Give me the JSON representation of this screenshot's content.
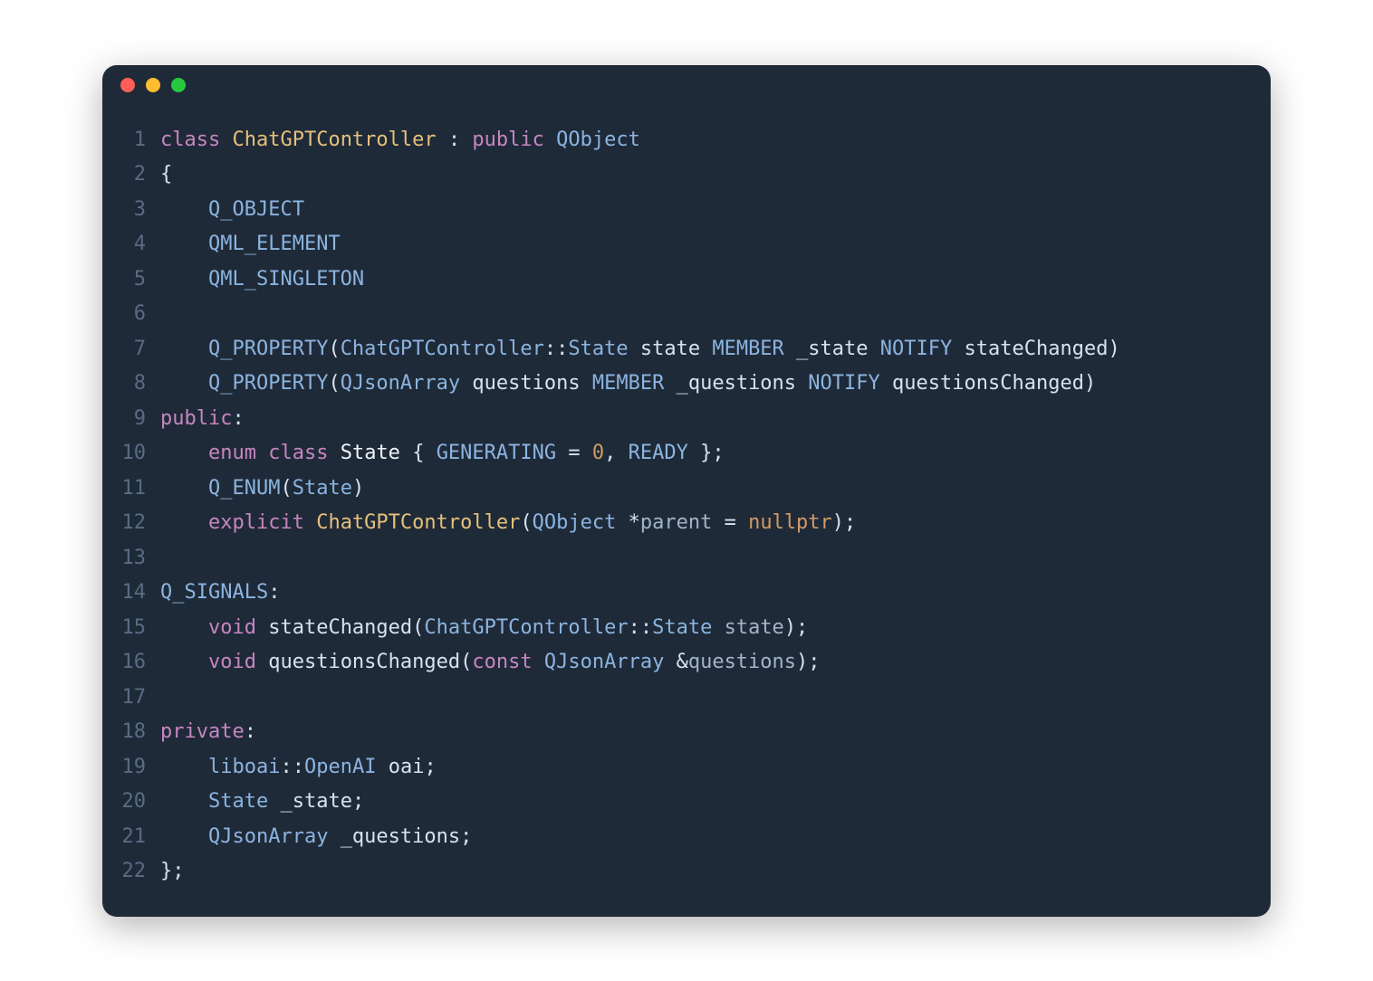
{
  "window": {
    "traffic_lights": {
      "close_color": "#ff5f56",
      "minimize_color": "#ffbd2e",
      "maximize_color": "#27c93f"
    }
  },
  "code": {
    "lines": [
      {
        "n": "1",
        "tokens": [
          [
            "keyword",
            "class"
          ],
          [
            "plain",
            " "
          ],
          [
            "typedef",
            "ChatGPTController"
          ],
          [
            "plain",
            " "
          ],
          [
            "punct",
            ":"
          ],
          [
            "plain",
            " "
          ],
          [
            "keyword",
            "public"
          ],
          [
            "plain",
            " "
          ],
          [
            "type",
            "QObject"
          ]
        ]
      },
      {
        "n": "2",
        "tokens": [
          [
            "punct",
            "{"
          ]
        ]
      },
      {
        "n": "3",
        "tokens": [
          [
            "plain",
            "    "
          ],
          [
            "macro",
            "Q_OBJECT"
          ]
        ]
      },
      {
        "n": "4",
        "tokens": [
          [
            "plain",
            "    "
          ],
          [
            "macro",
            "QML_ELEMENT"
          ]
        ]
      },
      {
        "n": "5",
        "tokens": [
          [
            "plain",
            "    "
          ],
          [
            "macro",
            "QML_SINGLETON"
          ]
        ]
      },
      {
        "n": "6",
        "tokens": [
          [
            "plain",
            " "
          ]
        ]
      },
      {
        "n": "7",
        "tokens": [
          [
            "plain",
            "    "
          ],
          [
            "macro",
            "Q_PROPERTY"
          ],
          [
            "punct",
            "("
          ],
          [
            "type",
            "ChatGPTController"
          ],
          [
            "punct",
            "::"
          ],
          [
            "type",
            "State"
          ],
          [
            "plain",
            " "
          ],
          [
            "ident",
            "state"
          ],
          [
            "plain",
            " "
          ],
          [
            "macro",
            "MEMBER"
          ],
          [
            "plain",
            " "
          ],
          [
            "ident",
            "_state"
          ],
          [
            "plain",
            " "
          ],
          [
            "macro",
            "NOTIFY"
          ],
          [
            "plain",
            " "
          ],
          [
            "ident",
            "stateChanged"
          ],
          [
            "punct",
            ")"
          ]
        ]
      },
      {
        "n": "8",
        "tokens": [
          [
            "plain",
            "    "
          ],
          [
            "macro",
            "Q_PROPERTY"
          ],
          [
            "punct",
            "("
          ],
          [
            "type",
            "QJsonArray"
          ],
          [
            "plain",
            " "
          ],
          [
            "ident",
            "questions"
          ],
          [
            "plain",
            " "
          ],
          [
            "macro",
            "MEMBER"
          ],
          [
            "plain",
            " "
          ],
          [
            "ident",
            "_questions"
          ],
          [
            "plain",
            " "
          ],
          [
            "macro",
            "NOTIFY"
          ],
          [
            "plain",
            " "
          ],
          [
            "ident",
            "questionsChanged"
          ],
          [
            "punct",
            ")"
          ]
        ]
      },
      {
        "n": "9",
        "tokens": [
          [
            "keyword",
            "public"
          ],
          [
            "punct",
            ":"
          ]
        ]
      },
      {
        "n": "10",
        "tokens": [
          [
            "plain",
            "    "
          ],
          [
            "keyword",
            "enum"
          ],
          [
            "plain",
            " "
          ],
          [
            "keyword",
            "class"
          ],
          [
            "plain",
            " "
          ],
          [
            "white",
            "State"
          ],
          [
            "plain",
            " "
          ],
          [
            "punct",
            "{"
          ],
          [
            "plain",
            " "
          ],
          [
            "enumval",
            "GENERATING"
          ],
          [
            "plain",
            " "
          ],
          [
            "punct",
            "="
          ],
          [
            "plain",
            " "
          ],
          [
            "number",
            "0"
          ],
          [
            "punct",
            ","
          ],
          [
            "plain",
            " "
          ],
          [
            "enumval",
            "READY"
          ],
          [
            "plain",
            " "
          ],
          [
            "punct",
            "};"
          ]
        ]
      },
      {
        "n": "11",
        "tokens": [
          [
            "plain",
            "    "
          ],
          [
            "macro",
            "Q_ENUM"
          ],
          [
            "punct",
            "("
          ],
          [
            "type",
            "State"
          ],
          [
            "punct",
            ")"
          ]
        ]
      },
      {
        "n": "12",
        "tokens": [
          [
            "plain",
            "    "
          ],
          [
            "keyword",
            "explicit"
          ],
          [
            "plain",
            " "
          ],
          [
            "typedef",
            "ChatGPTController"
          ],
          [
            "punct",
            "("
          ],
          [
            "type",
            "QObject"
          ],
          [
            "plain",
            " "
          ],
          [
            "punct",
            "*"
          ],
          [
            "param",
            "parent"
          ],
          [
            "plain",
            " "
          ],
          [
            "punct",
            "="
          ],
          [
            "plain",
            " "
          ],
          [
            "null",
            "nullptr"
          ],
          [
            "punct",
            ");"
          ]
        ]
      },
      {
        "n": "13",
        "tokens": [
          [
            "plain",
            " "
          ]
        ]
      },
      {
        "n": "14",
        "tokens": [
          [
            "macro",
            "Q_SIGNALS"
          ],
          [
            "punct",
            ":"
          ]
        ]
      },
      {
        "n": "15",
        "tokens": [
          [
            "plain",
            "    "
          ],
          [
            "keyword",
            "void"
          ],
          [
            "plain",
            " "
          ],
          [
            "func",
            "stateChanged"
          ],
          [
            "punct",
            "("
          ],
          [
            "type",
            "ChatGPTController"
          ],
          [
            "punct",
            "::"
          ],
          [
            "type",
            "State"
          ],
          [
            "plain",
            " "
          ],
          [
            "param",
            "state"
          ],
          [
            "punct",
            ");"
          ]
        ]
      },
      {
        "n": "16",
        "tokens": [
          [
            "plain",
            "    "
          ],
          [
            "keyword",
            "void"
          ],
          [
            "plain",
            " "
          ],
          [
            "func",
            "questionsChanged"
          ],
          [
            "punct",
            "("
          ],
          [
            "keyword",
            "const"
          ],
          [
            "plain",
            " "
          ],
          [
            "type",
            "QJsonArray"
          ],
          [
            "plain",
            " "
          ],
          [
            "punct",
            "&"
          ],
          [
            "param",
            "questions"
          ],
          [
            "punct",
            ");"
          ]
        ]
      },
      {
        "n": "17",
        "tokens": [
          [
            "plain",
            " "
          ]
        ]
      },
      {
        "n": "18",
        "tokens": [
          [
            "keyword",
            "private"
          ],
          [
            "punct",
            ":"
          ]
        ]
      },
      {
        "n": "19",
        "tokens": [
          [
            "plain",
            "    "
          ],
          [
            "type",
            "liboai"
          ],
          [
            "punct",
            "::"
          ],
          [
            "type",
            "OpenAI"
          ],
          [
            "plain",
            " "
          ],
          [
            "ident",
            "oai"
          ],
          [
            "punct",
            ";"
          ]
        ]
      },
      {
        "n": "20",
        "tokens": [
          [
            "plain",
            "    "
          ],
          [
            "type",
            "State"
          ],
          [
            "plain",
            " "
          ],
          [
            "ident",
            "_state"
          ],
          [
            "punct",
            ";"
          ]
        ]
      },
      {
        "n": "21",
        "tokens": [
          [
            "plain",
            "    "
          ],
          [
            "type",
            "QJsonArray"
          ],
          [
            "plain",
            " "
          ],
          [
            "ident",
            "_questions"
          ],
          [
            "punct",
            ";"
          ]
        ]
      },
      {
        "n": "22",
        "tokens": [
          [
            "punct",
            "};"
          ]
        ]
      }
    ]
  }
}
